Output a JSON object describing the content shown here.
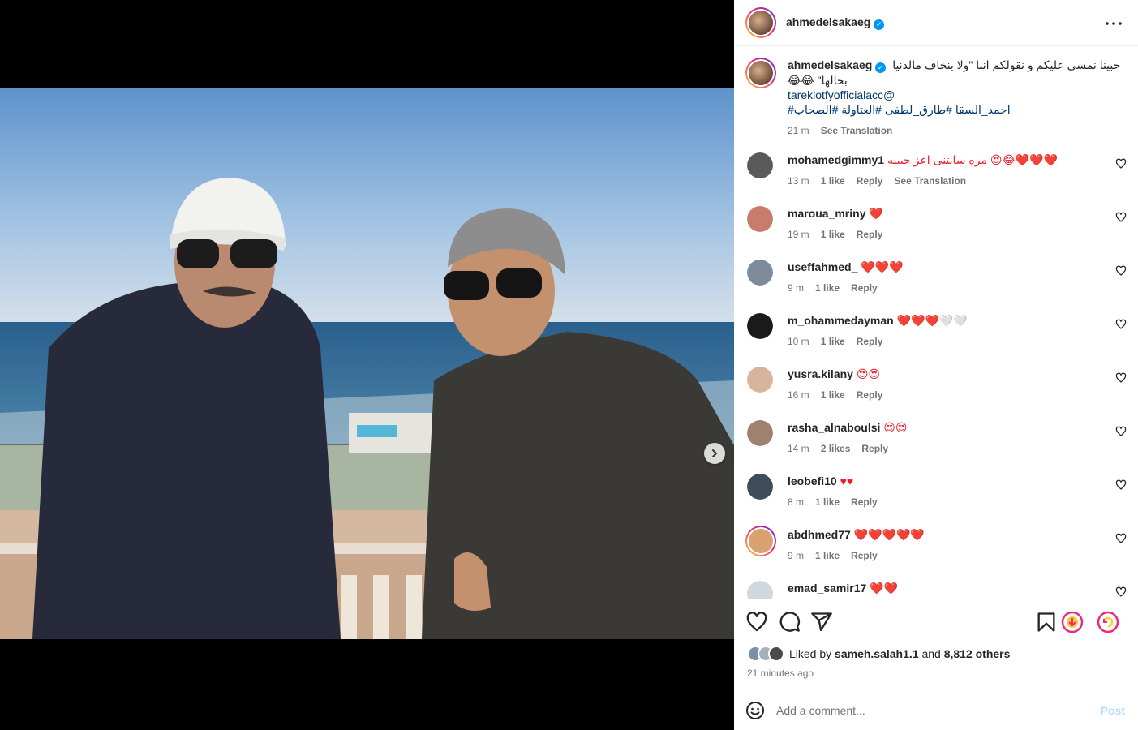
{
  "post": {
    "username": "ahmedelsakaeg",
    "verified": true,
    "more_icon": "more-horizontal-icon"
  },
  "caption": {
    "username": "ahmedelsakaeg",
    "text_line1": "حبينا نمسى عليكم و نقولكم اننا \"ولا بنخاف مالدنيا",
    "text_line2": "😂😂 \"بحالها",
    "mention": "tareklotfyofficialacc@",
    "hashtags": "#احمد_السقا #طارق_لطفى #العتاولة #الصحاب",
    "time": "21 m",
    "see_translation": "See Translation"
  },
  "comments": [
    {
      "username": "mohamedgimmy1",
      "text": "مره سابتنى اعز حبيبه 😍😂❤️❤️❤️",
      "time": "13 m",
      "likes": "1 like",
      "reply": "Reply",
      "extra": "See Translation",
      "ringed": false
    },
    {
      "username": "maroua_mriny",
      "text": "❤️",
      "time": "19 m",
      "likes": "1 like",
      "reply": "Reply",
      "extra": "",
      "ringed": false
    },
    {
      "username": "useffahmed_",
      "text": "❤️❤️❤️",
      "time": "9 m",
      "likes": "1 like",
      "reply": "Reply",
      "extra": "",
      "ringed": false
    },
    {
      "username": "m_ohammedayman",
      "text": "❤️❤️❤️🤍🤍",
      "time": "10 m",
      "likes": "1 like",
      "reply": "Reply",
      "extra": "",
      "ringed": false
    },
    {
      "username": "yusra.kilany",
      "text": "😍😍",
      "time": "16 m",
      "likes": "1 like",
      "reply": "Reply",
      "extra": "",
      "ringed": false
    },
    {
      "username": "rasha_alnaboulsi",
      "text": "😍😍",
      "time": "14 m",
      "likes": "2 likes",
      "reply": "Reply",
      "extra": "",
      "ringed": false
    },
    {
      "username": "leobefi10",
      "text": "♥♥",
      "time": "8 m",
      "likes": "1 like",
      "reply": "Reply",
      "extra": "",
      "ringed": false
    },
    {
      "username": "abdhmed77",
      "text": "❤️❤️❤️❤️❤️",
      "time": "9 m",
      "likes": "1 like",
      "reply": "Reply",
      "extra": "",
      "ringed": true
    },
    {
      "username": "emad_samir17",
      "text": "❤️❤️",
      "time": "",
      "likes": "",
      "reply": "",
      "extra": "",
      "ringed": false
    }
  ],
  "actions": {
    "like_icon": "heart-icon",
    "comment_icon": "comment-icon",
    "share_icon": "share-icon",
    "save_icon": "bookmark-icon"
  },
  "likes": {
    "prefix": "Liked by",
    "user": "sameh.salah1.1",
    "middle": "and",
    "others": "8,812 others"
  },
  "time_ago": "21 minutes ago",
  "add_comment": {
    "placeholder": "Add a comment...",
    "post_label": "Post",
    "emoji_icon": "emoji-icon"
  },
  "colors": {
    "accent": "#0095f6",
    "heart_red": "#ed1f2a",
    "link": "#00376b"
  }
}
